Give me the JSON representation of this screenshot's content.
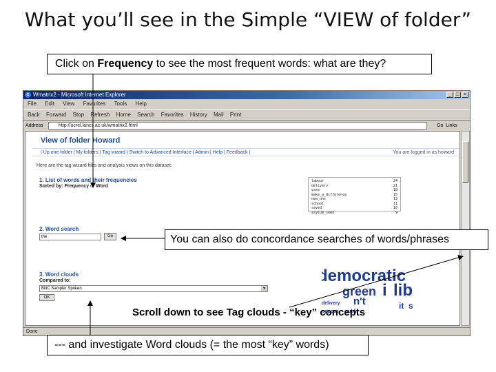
{
  "slide": {
    "title": "What you’ll see in the Simple “VIEW of folder”",
    "callout_frequency_pre": "Click on ",
    "callout_frequency_bold": "Frequency",
    "callout_frequency_post": " to see the most frequent words: what are they?",
    "callout_concordance": "You can also do concordance searches of words/phrases",
    "callout_tagclouds": "Scroll down to see Tag clouds - “key” concepts",
    "callout_wordclouds": "--- and investigate Word clouds (= the most “key” words)"
  },
  "browser": {
    "window_title": "Wmatrix2 - Microsoft Internet Explorer",
    "menu": [
      "File",
      "Edit",
      "View",
      "Favorites",
      "Tools",
      "Help"
    ],
    "toolbar": [
      "Back",
      "Forward",
      "Stop",
      "Refresh",
      "Home",
      "Search",
      "Favorites",
      "History",
      "Mail",
      "Print"
    ],
    "address_label": "Address",
    "address_value": "http://ucrel.lancs.ac.uk/wmatrix2.html",
    "go_label": "Go",
    "links_label": "Links",
    "status_text": "Done"
  },
  "page": {
    "heading": "View of folder Howard",
    "nav": "| Up one folder | My folders | Tag wizard | Switch to Advanced Interface | Admin | Help | Feedback |",
    "logged_in": "You are logged in as howard",
    "intro": "Here are the tag wizard files and analysis views on this dataset:",
    "section1_title": "1. List of words and their frequencies",
    "sorted_by_prefix": "Sorted by:",
    "sorted_by_frequency": "Frequency",
    "sorted_by_or": "or",
    "sorted_by_word": "Word",
    "section2_title": "2. Word search",
    "search_value": "the",
    "search_button": "Go",
    "section3_title": "3. Word clouds",
    "compared_to": "Compared to:",
    "compare_select": "BNC Sampler Spoken",
    "ok_button": "OK"
  },
  "wordlist_rows": [
    {
      "word": "labour",
      "freq": "24"
    },
    {
      "word": "delivery",
      "freq": "21"
    },
    {
      "word": "care",
      "freq": "18"
    },
    {
      "word": "make_a_difference",
      "freq": "15"
    },
    {
      "word": "new_nhs",
      "freq": "13"
    },
    {
      "word": "school",
      "freq": "11"
    },
    {
      "word": "saved",
      "freq": "10"
    },
    {
      "word": "asylum_seek",
      "freq": "9"
    }
  ],
  "word_cloud": {
    "words": [
      "democratic",
      "green",
      "i",
      "lib",
      "delivery",
      "n't",
      "oppose",
      "publi",
      "it",
      "s"
    ]
  },
  "colors": {
    "link_blue": "#1f4e9c",
    "titlebar": "#0a246a",
    "window_chrome": "#d4d0c8"
  }
}
